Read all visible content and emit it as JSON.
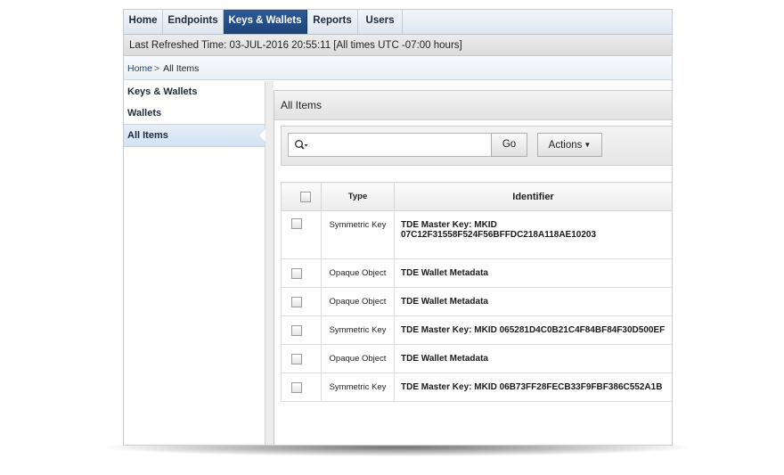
{
  "tabs": [
    {
      "label": "Home",
      "active": false
    },
    {
      "label": "Endpoints",
      "active": false
    },
    {
      "label": "Keys & Wallets",
      "active": true
    },
    {
      "label": "Reports",
      "active": false
    },
    {
      "label": "Users",
      "active": false
    }
  ],
  "status_bar": {
    "text": "Last Refreshed Time: 03-JUL-2016 20:55:11 [All times UTC -07:00 hours]"
  },
  "breadcrumb": {
    "home": "Home",
    "separator": ">",
    "current": "All Items"
  },
  "sidebar": {
    "items": [
      {
        "label": "Keys & Wallets",
        "selected": false
      },
      {
        "label": "Wallets",
        "selected": false
      },
      {
        "label": "All Items",
        "selected": true
      }
    ]
  },
  "region": {
    "title": "All Items"
  },
  "search": {
    "value": "",
    "placeholder": "",
    "icon": "search-icon"
  },
  "toolbar": {
    "go_label": "Go",
    "actions_label": "Actions"
  },
  "table": {
    "columns": [
      "",
      "Type",
      "Identifier"
    ],
    "rows": [
      {
        "type": "Symmetric Key",
        "identifier_line1": "TDE Master Key: MKID",
        "identifier_line2": "07C12F31558F524F56BFFDC218A118AE10203"
      },
      {
        "type": "Opaque Object",
        "identifier": "TDE Wallet Metadata"
      },
      {
        "type": "Opaque Object",
        "identifier": "TDE Wallet Metadata"
      },
      {
        "type": "Symmetric Key",
        "identifier": "TDE Master Key: MKID 065281D4C0B21C4F84BF84F30D500EF"
      },
      {
        "type": "Opaque Object",
        "identifier": "TDE Wallet Metadata"
      },
      {
        "type": "Symmetric Key",
        "identifier": "TDE Master Key: MKID 06B73FF28FECB33F9FBF386C552A1B"
      }
    ]
  },
  "colors": {
    "active_tab": "#1d4479",
    "selected_sidebar": "#d2e1f1",
    "link": "#1d4479"
  }
}
